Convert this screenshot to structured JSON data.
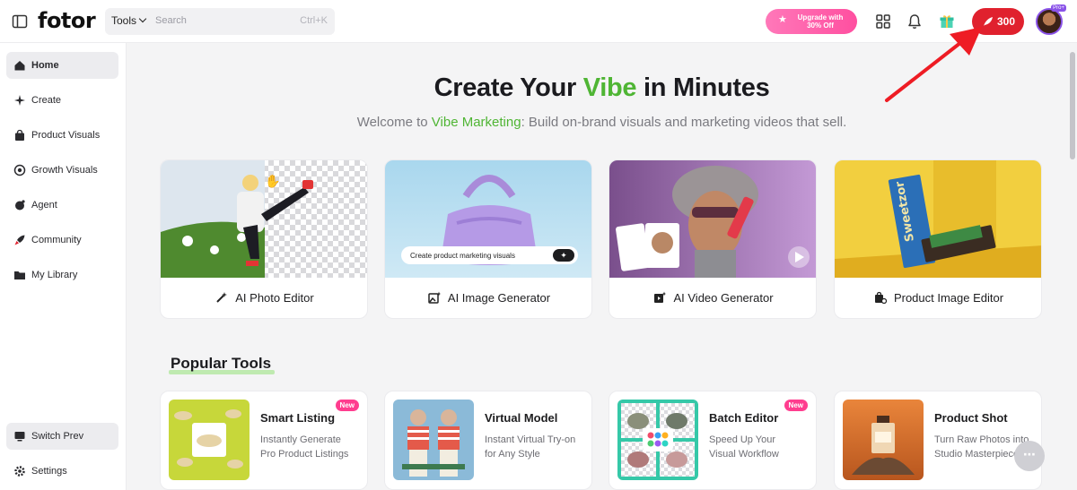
{
  "header": {
    "logo": "fotor",
    "tools_label": "Tools",
    "search_placeholder": "Search",
    "search_shortcut": "Ctrl+K",
    "upgrade_line1": "Upgrade with",
    "upgrade_line2": "30% Off",
    "credits": "300",
    "avatar_badge": "Pro+"
  },
  "sidebar": {
    "items": [
      {
        "label": "Home",
        "icon": "home-icon"
      },
      {
        "label": "Create",
        "icon": "sparkle-icon"
      },
      {
        "label": "Product Visuals",
        "icon": "shopping-bag-icon"
      },
      {
        "label": "Growth Visuals",
        "icon": "target-icon"
      },
      {
        "label": "Agent",
        "icon": "agent-icon"
      },
      {
        "label": "Community",
        "icon": "rocket-icon"
      },
      {
        "label": "My Library",
        "icon": "folder-icon"
      }
    ],
    "switch_prev": "Switch Prev",
    "settings": "Settings"
  },
  "hero": {
    "title_before": "Create Your ",
    "title_highlight": "Vibe",
    "title_after": " in Minutes",
    "subtitle_before": "Welcome to ",
    "subtitle_highlight": "Vibe Marketing",
    "subtitle_after": ": Build on-brand visuals and marketing videos that sell.",
    "accent_color": "#4fb534"
  },
  "feature_cards": [
    {
      "label": "AI Photo Editor",
      "icon": "magic-wand-icon"
    },
    {
      "label": "AI Image Generator",
      "icon": "image-sparkle-icon",
      "prompt_text": "Create product marketing visuals"
    },
    {
      "label": "AI Video Generator",
      "icon": "video-sparkle-icon"
    },
    {
      "label": "Product Image Editor",
      "icon": "product-edit-icon",
      "box_text": "Sweetzor"
    }
  ],
  "popular": {
    "title": "Popular Tools",
    "tools": [
      {
        "title": "Smart Listing",
        "desc": "Instantly Generate\nPro Product Listings",
        "badge": "New"
      },
      {
        "title": "Virtual Model",
        "desc": "Instant Virtual Try-on\nfor Any Style",
        "badge": ""
      },
      {
        "title": "Batch Editor",
        "desc": "Speed Up Your\nVisual Workflow",
        "badge": "New"
      },
      {
        "title": "Product Shot",
        "desc": "Turn Raw Photos into\nStudio Masterpieces",
        "badge": ""
      }
    ]
  },
  "colors": {
    "credits_red": "#e0212e",
    "upgrade_pink": "#ff4fa0",
    "new_badge": "#ff3d8f",
    "annotation_arrow": "#ee1c24"
  }
}
